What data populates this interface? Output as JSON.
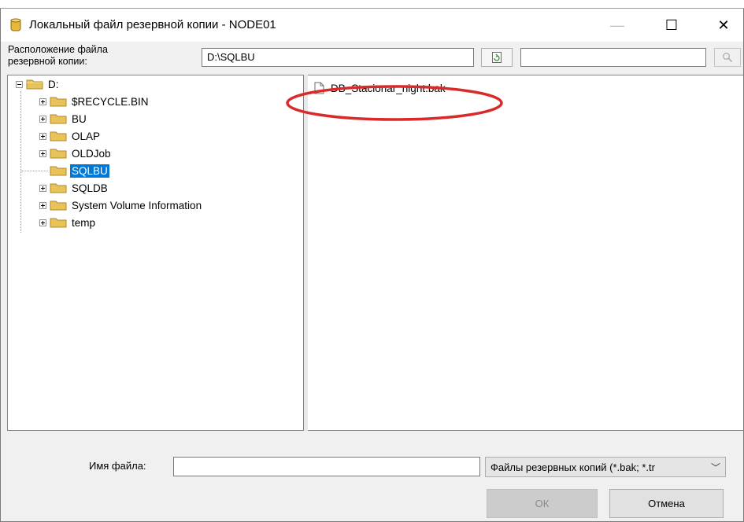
{
  "window": {
    "title": "Локальный файл резервной копии - NODE01",
    "controls": {
      "minimize": "—",
      "maximize": "☐",
      "close": "✕"
    }
  },
  "location": {
    "label_line1": "Расположение файла",
    "label_line2": "резервной копии:",
    "path_value": "D:\\SQLBU",
    "search_value": "",
    "refresh_icon": "refresh-icon",
    "search_icon": "search-icon"
  },
  "tree": {
    "root": "D:",
    "items": [
      {
        "label": "$RECYCLE.BIN",
        "expandable": true,
        "selected": false
      },
      {
        "label": "BU",
        "expandable": true,
        "selected": false
      },
      {
        "label": "OLAP",
        "expandable": true,
        "selected": false
      },
      {
        "label": "OLDJob",
        "expandable": true,
        "selected": false
      },
      {
        "label": "SQLBU",
        "expandable": false,
        "selected": true
      },
      {
        "label": "SQLDB",
        "expandable": true,
        "selected": false
      },
      {
        "label": "System Volume Information",
        "expandable": true,
        "selected": false
      },
      {
        "label": "temp",
        "expandable": true,
        "selected": false
      }
    ]
  },
  "files": [
    {
      "name": "DB_Stacionar_night.bak",
      "highlighted": true
    }
  ],
  "footer": {
    "filename_label": "Имя файла:",
    "filename_value": "",
    "filter_value": "Файлы резервных копий (*.bak; *.tr",
    "ok_label": "ОК",
    "cancel_label": "Отмена"
  },
  "colors": {
    "selection": "#0078d7",
    "annotation": "#d92a2a",
    "folder": "#e8c35a"
  }
}
